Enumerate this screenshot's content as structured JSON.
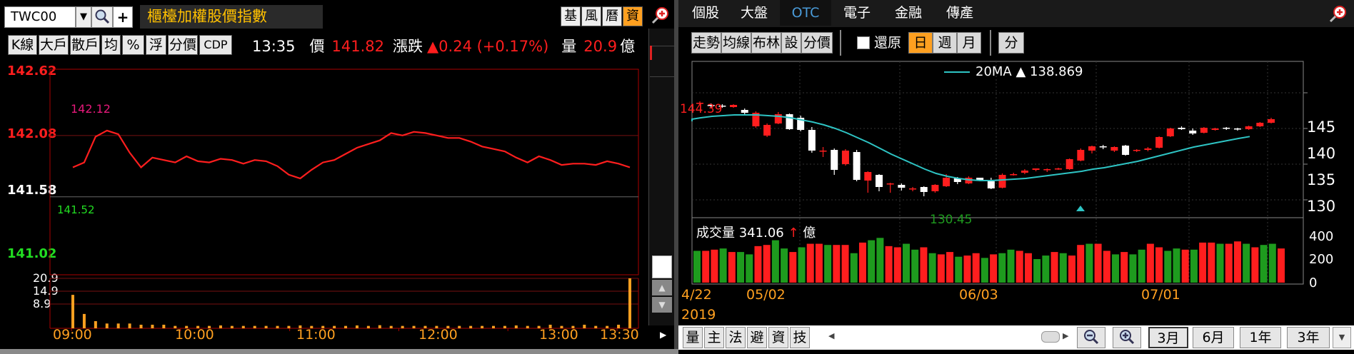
{
  "left": {
    "symbol": "TWC00",
    "title": "櫃檯加權股價指數",
    "tags": [
      "基",
      "風",
      "曆",
      "資"
    ],
    "toolbar": [
      "K線",
      "大戶",
      "散戶",
      "均",
      "%",
      "浮",
      "分價",
      "CDP"
    ],
    "time": "13:35",
    "price_label": "價",
    "price": "141.82",
    "change_label": "漲跌",
    "change": "▲0.24 (+0.17%)",
    "volume_label": "量",
    "volume": "20.9",
    "volume_unit": "億",
    "price_axis": [
      "142.62",
      "142.08",
      "141.58",
      "141.02"
    ],
    "volume_axis": [
      "20.9",
      "14.9",
      "8.9"
    ],
    "high_label": "142.12",
    "low_label": "141.52",
    "time_axis": [
      "09:00",
      "10:00",
      "11:00",
      "12:00",
      "13:00",
      "13:30"
    ]
  },
  "right": {
    "tabs": [
      "個股",
      "大盤",
      "OTC",
      "電子",
      "金融",
      "傳產"
    ],
    "active_tab": "OTC",
    "tools": [
      "走勢",
      "均線",
      "布林",
      "設",
      "分價"
    ],
    "restore_label": "還原",
    "periods": [
      "日",
      "週",
      "月"
    ],
    "active_period": "日",
    "split_label": "分",
    "ma_label": "20MA",
    "ma_value": "▲ 138.869",
    "high_label": "144.39",
    "low_label": "130.45",
    "price_axis": [
      "145",
      "140",
      "135",
      "130"
    ],
    "vol_title": "成交量",
    "vol_value": "341.06",
    "vol_arrow": "↑",
    "vol_unit": "億",
    "vol_axis": [
      "400",
      "200",
      "0"
    ],
    "date_axis": [
      "4/22",
      "05/02",
      "06/03",
      "07/01"
    ],
    "year": "2019",
    "bottom_tabs": [
      "量",
      "主",
      "法",
      "避",
      "資",
      "技"
    ],
    "ranges": [
      "3月",
      "6月",
      "1年",
      "3年"
    ],
    "active_range": "3月"
  },
  "colors": {
    "up": "#ff1e1e",
    "down": "#ffffff",
    "green": "#1e9b1e",
    "ma": "#2ec4c4",
    "orange": "#ffa020"
  },
  "chart_data": [
    {
      "type": "line",
      "title": "",
      "x_range": [
        "09:00",
        "13:30"
      ],
      "ylim": [
        141.02,
        142.62
      ],
      "series": [
        {
          "values": [
            141.82,
            141.86,
            142.07,
            142.12,
            142.09,
            141.94,
            141.82,
            141.9,
            141.88,
            141.86,
            141.91,
            141.87,
            141.86,
            141.89,
            141.88,
            141.85,
            141.88,
            141.87,
            141.83,
            141.76,
            141.73,
            141.8,
            141.86,
            141.88,
            141.93,
            141.98,
            142.01,
            142.04,
            142.1,
            142.08,
            142.11,
            142.1,
            142.08,
            142.06,
            142.06,
            142.03,
            141.99,
            141.97,
            141.95,
            141.9,
            141.86,
            141.91,
            141.88,
            141.84,
            141.85,
            141.85,
            141.84,
            141.87,
            141.85,
            141.82
          ]
        }
      ],
      "volume": {
        "ylim": [
          0,
          20.9
        ],
        "values": [
          14,
          6,
          3,
          2,
          2,
          2,
          1.5,
          1.5,
          1.5,
          1,
          1,
          1,
          1,
          1.2,
          1,
          1,
          1,
          1,
          1,
          1,
          1.2,
          1,
          1,
          1,
          1,
          1.2,
          1,
          1.3,
          1,
          1,
          1,
          1,
          1,
          1,
          1,
          1,
          1,
          1,
          1,
          1.2,
          1,
          1,
          1.5,
          1,
          1,
          1.5,
          1,
          1,
          1.5,
          20.9
        ]
      }
    },
    {
      "type": "candlestick",
      "title": "",
      "x": [
        "4/22",
        "05/02",
        "06/03",
        "07/01"
      ],
      "ylim": [
        128,
        147
      ],
      "candles": [
        [
          143.5,
          143.6,
          143.4,
          143.8
        ],
        [
          143.3,
          143.2,
          142.9,
          143.5
        ],
        [
          143.2,
          143.1,
          142.9,
          143.4
        ],
        [
          143.0,
          143.3,
          142.9,
          143.4
        ],
        [
          142.6,
          142.2,
          142.0,
          142.8
        ],
        [
          140.3,
          142.2,
          140.1,
          142.4
        ],
        [
          139.0,
          140.5,
          138.8,
          140.7
        ],
        [
          140.7,
          142.0,
          140.6,
          142.3
        ],
        [
          142.0,
          139.9,
          139.8,
          142.1
        ],
        [
          141.5,
          139.8,
          139.6,
          141.8
        ],
        [
          139.8,
          136.9,
          136.6,
          140.2
        ],
        [
          136.9,
          136.9,
          136.0,
          137.4
        ],
        [
          137.0,
          134.2,
          133.5,
          137.2
        ],
        [
          135.0,
          136.9,
          134.8,
          137.1
        ],
        [
          136.7,
          132.8,
          132.6,
          137.0
        ],
        [
          132.7,
          133.9,
          131.0,
          134.0
        ],
        [
          133.5,
          131.8,
          131.2,
          133.6
        ],
        [
          132.2,
          132.3,
          131.0,
          132.4
        ],
        [
          132.1,
          131.7,
          131.3,
          132.3
        ],
        [
          131.6,
          131.6,
          131.2,
          131.8
        ],
        [
          131.8,
          131.1,
          130.5,
          131.9
        ],
        [
          131.2,
          132.1,
          131.0,
          132.2
        ],
        [
          131.9,
          133.1,
          131.8,
          133.6
        ],
        [
          133.0,
          132.5,
          132.2,
          133.2
        ],
        [
          132.3,
          133.1,
          132.2,
          133.3
        ],
        [
          133.1,
          132.7,
          132.6,
          133.1
        ],
        [
          132.6,
          131.6,
          131.5,
          133.1
        ],
        [
          131.7,
          133.5,
          131.6,
          133.7
        ],
        [
          133.6,
          133.6,
          133.4,
          133.8
        ],
        [
          133.8,
          134.1,
          133.6,
          134.3
        ],
        [
          134.2,
          134.4,
          134.0,
          134.4
        ],
        [
          134.2,
          134.3,
          133.9,
          134.4
        ],
        [
          134.4,
          134.4,
          134.2,
          134.5
        ],
        [
          134.3,
          135.7,
          134.2,
          135.8
        ],
        [
          135.5,
          137.0,
          135.4,
          137.2
        ],
        [
          136.9,
          137.5,
          136.5,
          137.6
        ],
        [
          137.5,
          137.4,
          137.1,
          137.7
        ],
        [
          136.9,
          137.4,
          136.7,
          137.5
        ],
        [
          137.6,
          136.3,
          136.2,
          137.7
        ],
        [
          136.9,
          137.0,
          136.7,
          137.1
        ],
        [
          137.0,
          137.2,
          136.8,
          137.4
        ],
        [
          137.3,
          138.8,
          137.2,
          138.9
        ],
        [
          138.9,
          140.0,
          138.8,
          140.1
        ],
        [
          140.1,
          139.9,
          139.8,
          140.3
        ],
        [
          139.7,
          139.3,
          139.1,
          140.0
        ],
        [
          139.4,
          140.1,
          139.3,
          140.2
        ],
        [
          139.8,
          140.0,
          139.7,
          140.1
        ],
        [
          140.1,
          140.0,
          139.8,
          140.2
        ],
        [
          140.0,
          139.9,
          139.7,
          140.1
        ],
        [
          139.9,
          140.3,
          139.8,
          140.4
        ],
        [
          140.3,
          140.8,
          140.2,
          140.9
        ],
        [
          140.8,
          141.3,
          140.7,
          141.5
        ]
      ],
      "ma20": [
        141,
        141.3,
        141.5,
        141.7,
        141.8,
        141.9,
        141.9,
        141.9,
        141.8,
        141.7,
        141.5,
        141.2,
        140.9,
        140.5,
        140.0,
        139.4,
        138.7,
        138.0,
        137.2,
        136.4,
        135.7,
        135.0,
        134.3,
        133.7,
        133.3,
        133.0,
        132.8,
        132.7,
        132.7,
        132.8,
        132.9,
        133.0,
        133.2,
        133.4,
        133.6,
        133.8,
        134.0,
        134.3,
        134.5,
        134.8,
        135.1,
        135.4,
        135.8,
        136.2,
        136.6,
        137.0,
        137.4,
        137.7,
        138.0,
        138.3,
        138.6,
        138.869
      ],
      "volume_ylim": [
        0,
        400
      ],
      "volumes": [
        270,
        270,
        280,
        290,
        260,
        260,
        240,
        310,
        320,
        360,
        290,
        260,
        300,
        330,
        330,
        320,
        320,
        320,
        250,
        340,
        360,
        380,
        310,
        300,
        330,
        280,
        300,
        250,
        240,
        260,
        220,
        230,
        250,
        210,
        240,
        250,
        280,
        270,
        250,
        200,
        230,
        260,
        250,
        230,
        320,
        330,
        330,
        270,
        240,
        260,
        240,
        280,
        330,
        300,
        270,
        290,
        280,
        280,
        340,
        340,
        330,
        330,
        350,
        330,
        300,
        320,
        330,
        290
      ]
    }
  ]
}
